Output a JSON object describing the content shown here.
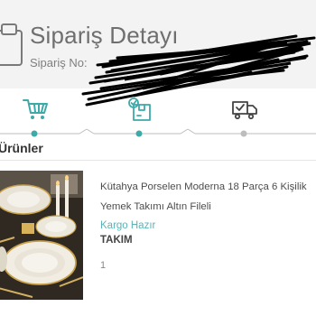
{
  "header": {
    "title": "Sipariş Detayı",
    "subtitle": "Sipariş No: "
  },
  "steps": [
    {
      "icon": "cart-icon",
      "active": true
    },
    {
      "icon": "package-check-icon",
      "active": true
    },
    {
      "icon": "delivery-truck-icon",
      "active": false
    }
  ],
  "colors": {
    "accent": "#3daaa8",
    "inactive": "#bdbdbd",
    "header_bg": "#f3f3f3"
  },
  "section": {
    "title": "Ürünler"
  },
  "product": {
    "name": "Kütahya Porselen Moderna 18 Parça 6 Kişilik Yemek Takımı Altın Fileli",
    "status": "Kargo Hazır",
    "brand": "TAKIM",
    "quantity": "1",
    "image_icon": "porcelain-dinner-set-image"
  }
}
